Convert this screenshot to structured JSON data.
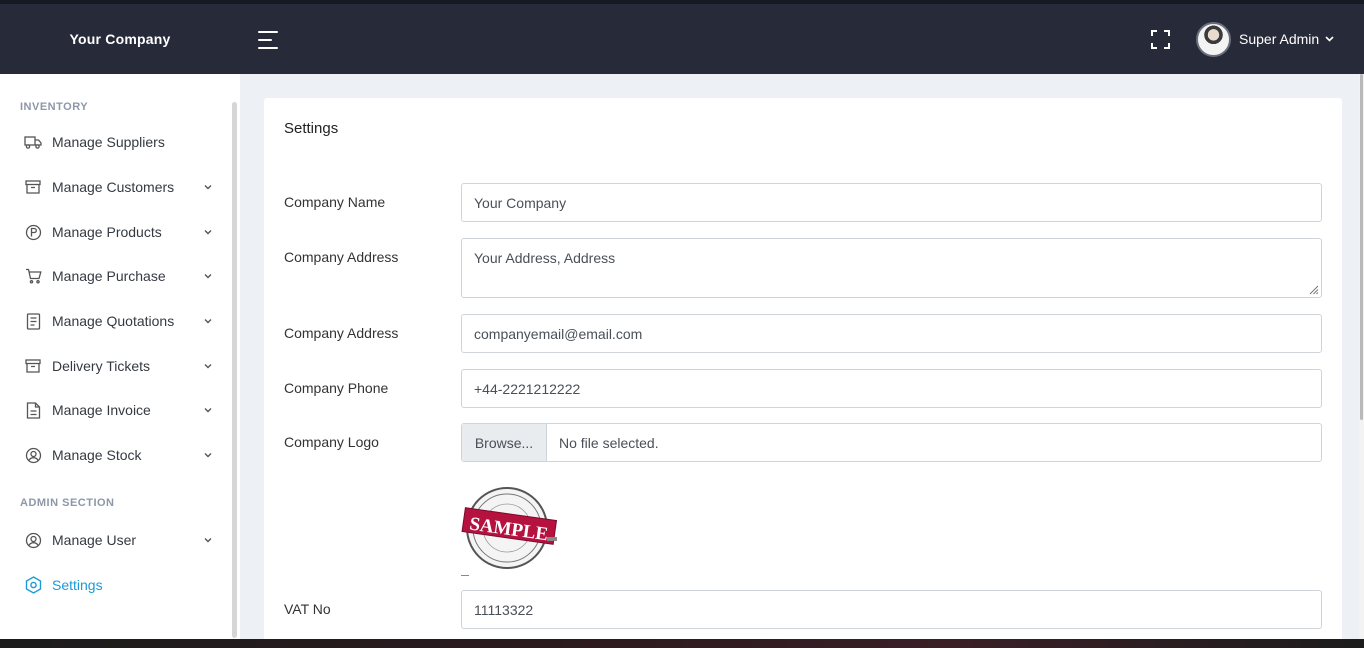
{
  "brand": {
    "name": "Your Company"
  },
  "header": {
    "user_name": "Super Admin",
    "icons": [
      "menu-icon",
      "fullscreen-icon",
      "chevron-down-icon"
    ]
  },
  "sidebar": {
    "inventory_title": "INVENTORY",
    "admin_title": "ADMIN SECTION",
    "items": [
      {
        "label": "Manage Suppliers",
        "icon": "truck-icon"
      },
      {
        "label": "Manage Customers",
        "icon": "archive-icon"
      },
      {
        "label": "Manage Products",
        "icon": "product-p-icon"
      },
      {
        "label": "Manage Purchase",
        "icon": "cart-icon"
      },
      {
        "label": "Manage Quotations",
        "icon": "document-icon"
      },
      {
        "label": "Delivery Tickets",
        "icon": "archive-icon"
      },
      {
        "label": "Manage Invoice",
        "icon": "invoice-icon"
      },
      {
        "label": "Manage Stock",
        "icon": "user-circle-icon"
      },
      {
        "label": "Manage User",
        "icon": "user-circle-icon"
      },
      {
        "label": "Settings",
        "icon": "gear-icon"
      }
    ],
    "active_color": "#1a9bd7"
  },
  "settings": {
    "title": "Settings",
    "fields": {
      "company_name": {
        "label": "Company Name",
        "value": "Your Company"
      },
      "company_address": {
        "label": "Company Address",
        "value": "Your Address, Address"
      },
      "company_email": {
        "label": "Company Address",
        "value": "companyemail@email.com"
      },
      "company_phone": {
        "label": "Company Phone",
        "value": "+44-2221212222"
      },
      "company_logo": {
        "label": "Company Logo",
        "button": "Browse...",
        "status": "No file selected."
      },
      "vat_no": {
        "label": "VAT No",
        "value": "11113322"
      }
    },
    "logo_text": "SAMPLE"
  },
  "colors": {
    "topbar": "#272b39",
    "stamp": "#b5123f"
  }
}
